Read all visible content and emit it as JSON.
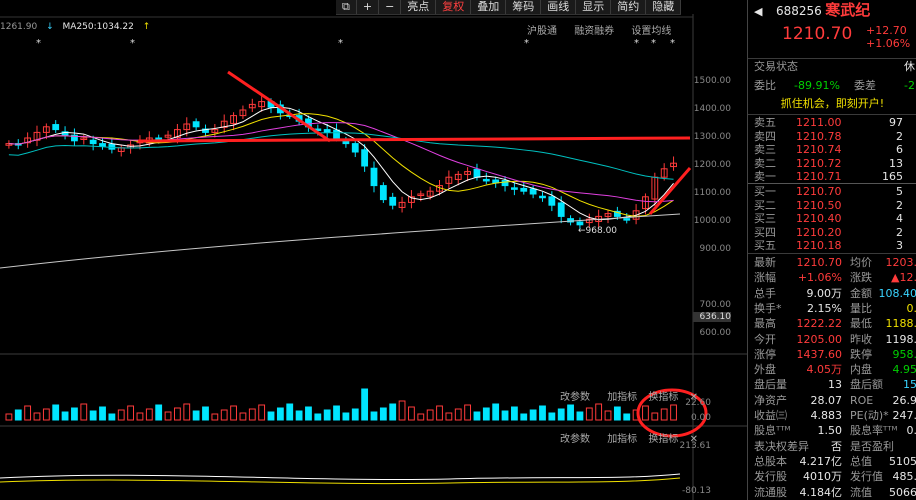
{
  "toolbar": {
    "items": [
      "⧉",
      "+",
      "−",
      "亮点",
      "复权",
      "叠加",
      "筹码",
      "画线",
      "显示",
      "简约",
      "隐藏"
    ],
    "active_index": 4
  },
  "chart_header": {
    "ma_left": "1261.90",
    "ma250_label": "MA250:1034.22",
    "tabs": [
      "沪股通",
      "融资融券",
      "设置均线"
    ]
  },
  "price_axis": {
    "ticks": [
      "1500.00",
      "1400.00",
      "1300.00",
      "1200.00",
      "1100.00",
      "1000.00",
      "900.00",
      "700.00",
      "636.10",
      "600.00"
    ]
  },
  "annotations": {
    "low_label": "←968.00"
  },
  "indicator_panels": {
    "vol_tabs": [
      "改参数",
      "加指标",
      "换指标",
      "✕"
    ],
    "vol_axis": [
      "22.60",
      "0.00"
    ],
    "macd_tabs": [
      "改参数",
      "加指标",
      "换指标",
      "✕"
    ],
    "macd_axis": [
      "213.61",
      "-80.13"
    ]
  },
  "colors": {
    "up": "#ff3b3b",
    "down": "#00e5ff",
    "ma5": "#ffffff",
    "ma10": "#f0e000",
    "ma20": "#e040e0",
    "ma60": "#00c0c0",
    "ma250": "#c8c8c8",
    "annotation": "#ff2020"
  },
  "stock": {
    "code": "688256",
    "name": "寒武纪",
    "price": "1210.70",
    "change": "+12.70",
    "change_pct": "+1.06%",
    "status_label": "交易状态",
    "status_right": "休",
    "weibi_label": "委比",
    "weibi_value": "-89.91%",
    "weicha_label": "委差",
    "weicha_value": "-2",
    "promo": "抓住机会，即刻开户!"
  },
  "orderbook": {
    "sell": [
      {
        "label": "卖五",
        "price": "1211.00",
        "vol": "97"
      },
      {
        "label": "卖四",
        "price": "1210.78",
        "vol": "2"
      },
      {
        "label": "卖三",
        "price": "1210.74",
        "vol": "6"
      },
      {
        "label": "卖二",
        "price": "1210.72",
        "vol": "13"
      },
      {
        "label": "卖一",
        "price": "1210.71",
        "vol": "165"
      }
    ],
    "buy": [
      {
        "label": "买一",
        "price": "1210.70",
        "vol": "5"
      },
      {
        "label": "买二",
        "price": "1210.50",
        "vol": "2"
      },
      {
        "label": "买三",
        "price": "1210.40",
        "vol": "4"
      },
      {
        "label": "买四",
        "price": "1210.20",
        "vol": "2"
      },
      {
        "label": "买五",
        "price": "1210.18",
        "vol": "3"
      }
    ]
  },
  "stats": [
    {
      "l1": "最新",
      "v1": "1210.70",
      "c1": "red",
      "l2": "均价",
      "v2": "1203.",
      "c2": "red"
    },
    {
      "l1": "涨幅",
      "v1": "+1.06%",
      "c1": "red",
      "l2": "涨跌",
      "v2": "▲12.",
      "c2": "red"
    },
    {
      "l1": "总手",
      "v1": "9.00万",
      "c1": "white",
      "l2": "金额",
      "v2": "108.40",
      "c2": "cyan"
    },
    {
      "l1": "换手*",
      "v1": "2.15%",
      "c1": "white",
      "l2": "量比",
      "v2": "0.",
      "c2": "yellow"
    },
    {
      "l1": "最高",
      "v1": "1222.22",
      "c1": "red",
      "l2": "最低",
      "v2": "1188.",
      "c2": "yellow"
    },
    {
      "l1": "今开",
      "v1": "1205.00",
      "c1": "red",
      "l2": "昨收",
      "v2": "1198.",
      "c2": "white"
    },
    {
      "l1": "涨停",
      "v1": "1437.60",
      "c1": "red",
      "l2": "跌停",
      "v2": "958.",
      "c2": "green"
    },
    {
      "l1": "外盘",
      "v1": "4.05万",
      "c1": "red",
      "l2": "内盘",
      "v2": "4.95",
      "c2": "green"
    },
    {
      "l1": "盘后量",
      "v1": "13",
      "c1": "white",
      "l2": "盘后额",
      "v2": "15",
      "c2": "cyan"
    },
    {
      "l1": "净资产",
      "v1": "28.07",
      "c1": "white",
      "l2": "ROE",
      "v2": "26.9",
      "c2": "white"
    },
    {
      "l1": "收益㈢",
      "v1": "4.883",
      "c1": "white",
      "l2": "PE(动)*",
      "v2": "247.",
      "c2": "white"
    },
    {
      "l1": "股息ᵀᵀᴹ",
      "v1": "1.50",
      "c1": "white",
      "l2": "股息率ᵀᵀᴹ",
      "v2": "0.",
      "c2": "white"
    },
    {
      "l1": "表决权差异",
      "v1": "否",
      "c1": "white",
      "l2": "是否盈利",
      "v2": "",
      "c2": "white"
    },
    {
      "l1": "总股本",
      "v1": "4.217亿",
      "c1": "white",
      "l2": "总值",
      "v2": "5105",
      "c2": "white"
    },
    {
      "l1": "发行股",
      "v1": "4010万",
      "c1": "white",
      "l2": "发行值",
      "v2": "485.",
      "c2": "white"
    },
    {
      "l1": "流通股",
      "v1": "4.184亿",
      "c1": "white",
      "l2": "流值",
      "v2": "5066",
      "c2": "white"
    }
  ]
}
